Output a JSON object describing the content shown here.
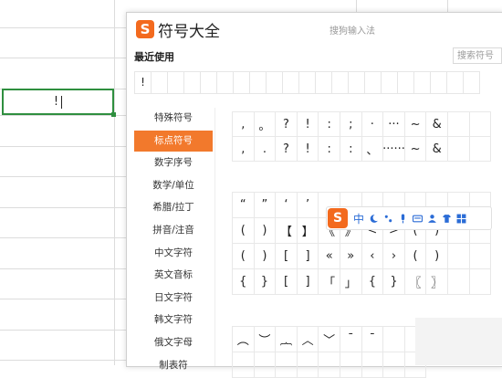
{
  "spreadsheet": {
    "active_cell_text": "!"
  },
  "popup": {
    "logo": "S",
    "title": "符号大全",
    "subtitle": "搜狗输入法",
    "recent_label": "最近使用",
    "search_placeholder": "搜索符号",
    "recent_symbols": [
      "!",
      "",
      "",
      "",
      "",
      "",
      "",
      "",
      "",
      "",
      "",
      "",
      "",
      "",
      "",
      "",
      "",
      "",
      "",
      "",
      ""
    ],
    "categories": [
      {
        "label": "特殊符号",
        "active": false
      },
      {
        "label": "标点符号",
        "active": true
      },
      {
        "label": "数字序号",
        "active": false
      },
      {
        "label": "数学/单位",
        "active": false
      },
      {
        "label": "希腊/拉丁",
        "active": false
      },
      {
        "label": "拼音/注音",
        "active": false
      },
      {
        "label": "中文字符",
        "active": false
      },
      {
        "label": "英文音标",
        "active": false
      },
      {
        "label": "日文字符",
        "active": false
      },
      {
        "label": "韩文字符",
        "active": false
      },
      {
        "label": "俄文字母",
        "active": false
      },
      {
        "label": "制表符",
        "active": false
      }
    ],
    "grid1": [
      ",",
      "。",
      "?",
      "!",
      ":",
      ";",
      "·",
      "···",
      "~",
      "&",
      "",
      "",
      ",",
      ".",
      "?",
      "!",
      ":",
      ":",
      "、",
      "······",
      "~",
      "&",
      "",
      ""
    ],
    "grid2": [
      "“",
      "”",
      "‘",
      "’",
      "",
      "",
      "",
      "",
      "",
      "",
      "",
      "",
      "(",
      ")",
      "【",
      "】",
      "《",
      "》",
      "<",
      ">",
      "(",
      ")",
      "",
      "",
      "(",
      ")",
      "[",
      "]",
      "«",
      "»",
      "‹",
      "›",
      "(",
      ")",
      "",
      "",
      "{",
      "}",
      "[",
      "]",
      "「",
      "」",
      "{",
      "}",
      "〖",
      "〗",
      "",
      ""
    ],
    "grid3": [
      "︵",
      "︶",
      "︷",
      "︿",
      "﹀",
      "ˉ",
      "¯",
      "",
      "",
      "",
      "",
      "",
      "",
      "",
      "",
      "",
      "",
      ""
    ]
  },
  "ime_toolbar": {
    "logo": "S",
    "mode": "中",
    "icons": [
      "moon-icon",
      "punctuation-icon",
      "microphone-icon",
      "keyboard-icon",
      "user-icon",
      "shirt-icon",
      "grid-icon"
    ],
    "accent_color": "#2b6cd6"
  },
  "colors": {
    "brand": "#f36a1e",
    "active_category": "#f2792c",
    "cell_border": "#2f8f3f"
  }
}
